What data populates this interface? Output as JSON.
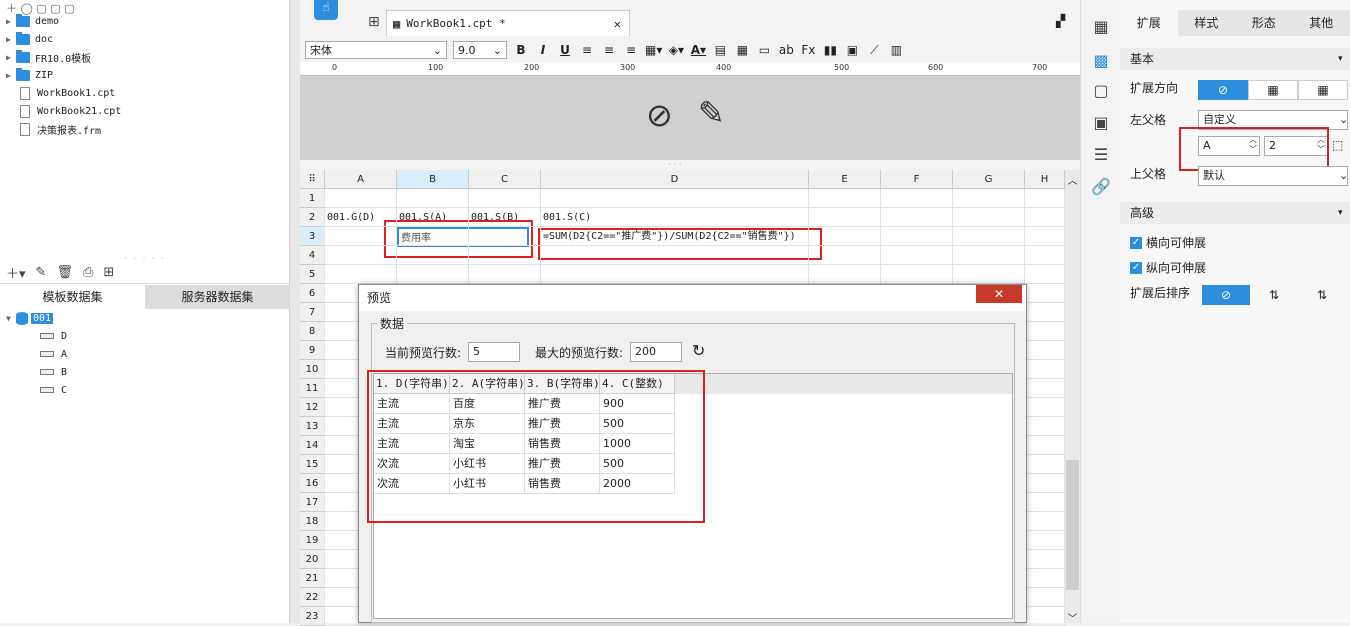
{
  "tree": {
    "items": [
      {
        "label": "demo",
        "type": "folder"
      },
      {
        "label": "doc",
        "type": "folder"
      },
      {
        "label": "FR10.0模板",
        "type": "folder"
      },
      {
        "label": "ZIP",
        "type": "folder"
      },
      {
        "label": "WorkBook1.cpt",
        "type": "file"
      },
      {
        "label": "WorkBook21.cpt",
        "type": "file"
      },
      {
        "label": "决策报表.frm",
        "type": "file"
      }
    ]
  },
  "dataset": {
    "tabs": [
      "模板数据集",
      "服务器数据集"
    ],
    "root": "001",
    "fields": [
      "D",
      "A",
      "B",
      "C"
    ]
  },
  "editor": {
    "tab_title": "WorkBook1.cpt *",
    "font": "宋体",
    "font_size": "9.0",
    "ruler": [
      "0",
      "100",
      "200",
      "300",
      "400",
      "500",
      "600",
      "700"
    ],
    "columns": [
      "A",
      "B",
      "C",
      "D",
      "E",
      "F",
      "G",
      "H"
    ],
    "rows": [
      "1",
      "2",
      "3",
      "4",
      "5",
      "6",
      "7",
      "8",
      "9",
      "10",
      "11",
      "12",
      "13",
      "14",
      "15",
      "16",
      "17",
      "18",
      "19",
      "20",
      "21",
      "22",
      "23"
    ],
    "cells": {
      "a2": "001.G(D)",
      "b2": "001.S(A)",
      "c2": "001.S(B)",
      "d2": "001.S(C)",
      "b3": "费用率",
      "d3": "=SUM(D2{C2==\"推广费\"})/SUM(D2{C2==\"销售费\"})"
    }
  },
  "right_panel": {
    "tabs": [
      "扩展",
      "样式",
      "形态",
      "其他"
    ],
    "basic_title": "基本",
    "expand_dir_label": "扩展方向",
    "left_parent_label": "左父格",
    "left_parent_value": "自定义",
    "left_parent_col": "A",
    "left_parent_row": "2",
    "up_parent_label": "上父格",
    "up_parent_value": "默认",
    "advanced_title": "高级",
    "h_expand": "横向可伸展",
    "v_expand": "纵向可伸展",
    "sort_label": "扩展后排序"
  },
  "preview": {
    "title": "预览",
    "group": "数据",
    "cur_rows_label": "当前预览行数:",
    "cur_rows": "5",
    "max_rows_label": "最大的预览行数:",
    "max_rows": "200",
    "headers": [
      "1. D(字符串)",
      "2. A(字符串)",
      "3. B(字符串)",
      "4. C(整数)"
    ],
    "rows": [
      [
        "主流",
        "百度",
        "推广费",
        "900"
      ],
      [
        "主流",
        "京东",
        "推广费",
        "500"
      ],
      [
        "主流",
        "淘宝",
        "销售费",
        "1000"
      ],
      [
        "次流",
        "小红书",
        "推广费",
        "500"
      ],
      [
        "次流",
        "小红书",
        "销售费",
        "2000"
      ]
    ]
  }
}
